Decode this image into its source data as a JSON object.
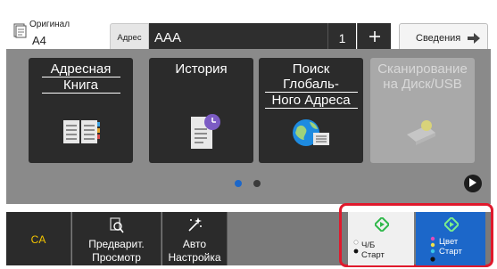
{
  "header": {
    "original_label": "Оригинал",
    "original_value": "A4",
    "address_tag": "Адрес",
    "address_value": "AAA",
    "address_count": "1",
    "details_label": "Сведения"
  },
  "tiles": [
    {
      "title_line1": "Адресная",
      "title_line2": "Книга",
      "icon": "address-book-icon"
    },
    {
      "title_line1": "История",
      "title_line2": "",
      "icon": "history-icon"
    },
    {
      "title_line1": "Поиск Глобаль-",
      "title_line2": "Ного Адреса",
      "icon": "global-address-icon"
    },
    {
      "title_line1": "Сканирование",
      "title_line2": "на Диск/USB",
      "icon": "scan-usb-icon"
    }
  ],
  "pager": {
    "pages": 2,
    "current": 1
  },
  "bottom": {
    "ca_label": "CA",
    "preview_line1": "Предварит.",
    "preview_line2": "Просмотр",
    "auto_line1": "Авто",
    "auto_line2": "Настройка",
    "bw_line1": "Ч/Б",
    "bw_line2": "Старт",
    "color_line1": "Цвет",
    "color_line2": "Старт"
  },
  "colors": {
    "accent_blue": "#1c67c9",
    "start_green": "#2fb84a",
    "highlight_red": "#e0192c",
    "ca_yellow": "#f3c400"
  }
}
